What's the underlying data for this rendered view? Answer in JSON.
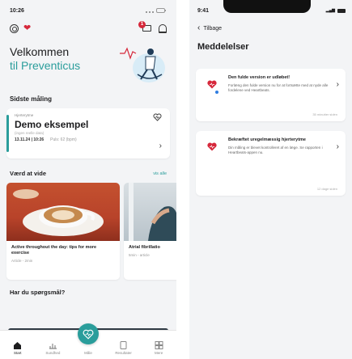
{
  "left": {
    "status_time": "10:26",
    "welcome_line1": "Velkommen",
    "welcome_line2": "til Preventicus",
    "notification_count": "1",
    "last_measurement_label": "Sidste måling",
    "measurement": {
      "type": "Hjerterytme",
      "title": "Demo eksempel",
      "subtitle": "(ingen reelle data)",
      "date": "13.11.24 | 10:26",
      "pulse": "Puls: 62 (bpm)"
    },
    "worth_knowing": "Værd at vide",
    "see_all": "vis alle",
    "articles": [
      {
        "title": "Active throughout the day: tips for more exercise",
        "meta": "Article - 2min"
      },
      {
        "title": "Atrial fibrillatio",
        "meta": "5min - article"
      }
    ],
    "questions_label": "Har du spørgsmål?",
    "tabs": [
      {
        "label": "Start",
        "icon": "home-icon"
      },
      {
        "label": "Sundhed",
        "icon": "chart-icon"
      },
      {
        "label": "Måle",
        "icon": "heart-measure-icon"
      },
      {
        "label": "Resultater",
        "icon": "document-icon"
      },
      {
        "label": "Mere",
        "icon": "grid-icon"
      }
    ]
  },
  "right": {
    "status_time": "9:41",
    "back_label": "Tilbage",
    "title": "Meddelelser",
    "messages": [
      {
        "title": "Den fulde version er udløbet!",
        "body": "Forlæng den fulde version nu for at fortsætte med at nyde alle fordelene ved Heartbeats.",
        "time": "35 minutter siden",
        "unread": true
      },
      {
        "title": "Bekræftet uregelmæssig hjerterytme",
        "body": "Din måling er blevet kontrolleret af en læge. Se rapporten i Heartbeats-appen nu.",
        "time": "12 dage siden",
        "unread": false
      }
    ]
  },
  "colors": {
    "accent": "#2a9d9b",
    "heart_red": "#d6283b",
    "unread_blue": "#2f7de1"
  }
}
